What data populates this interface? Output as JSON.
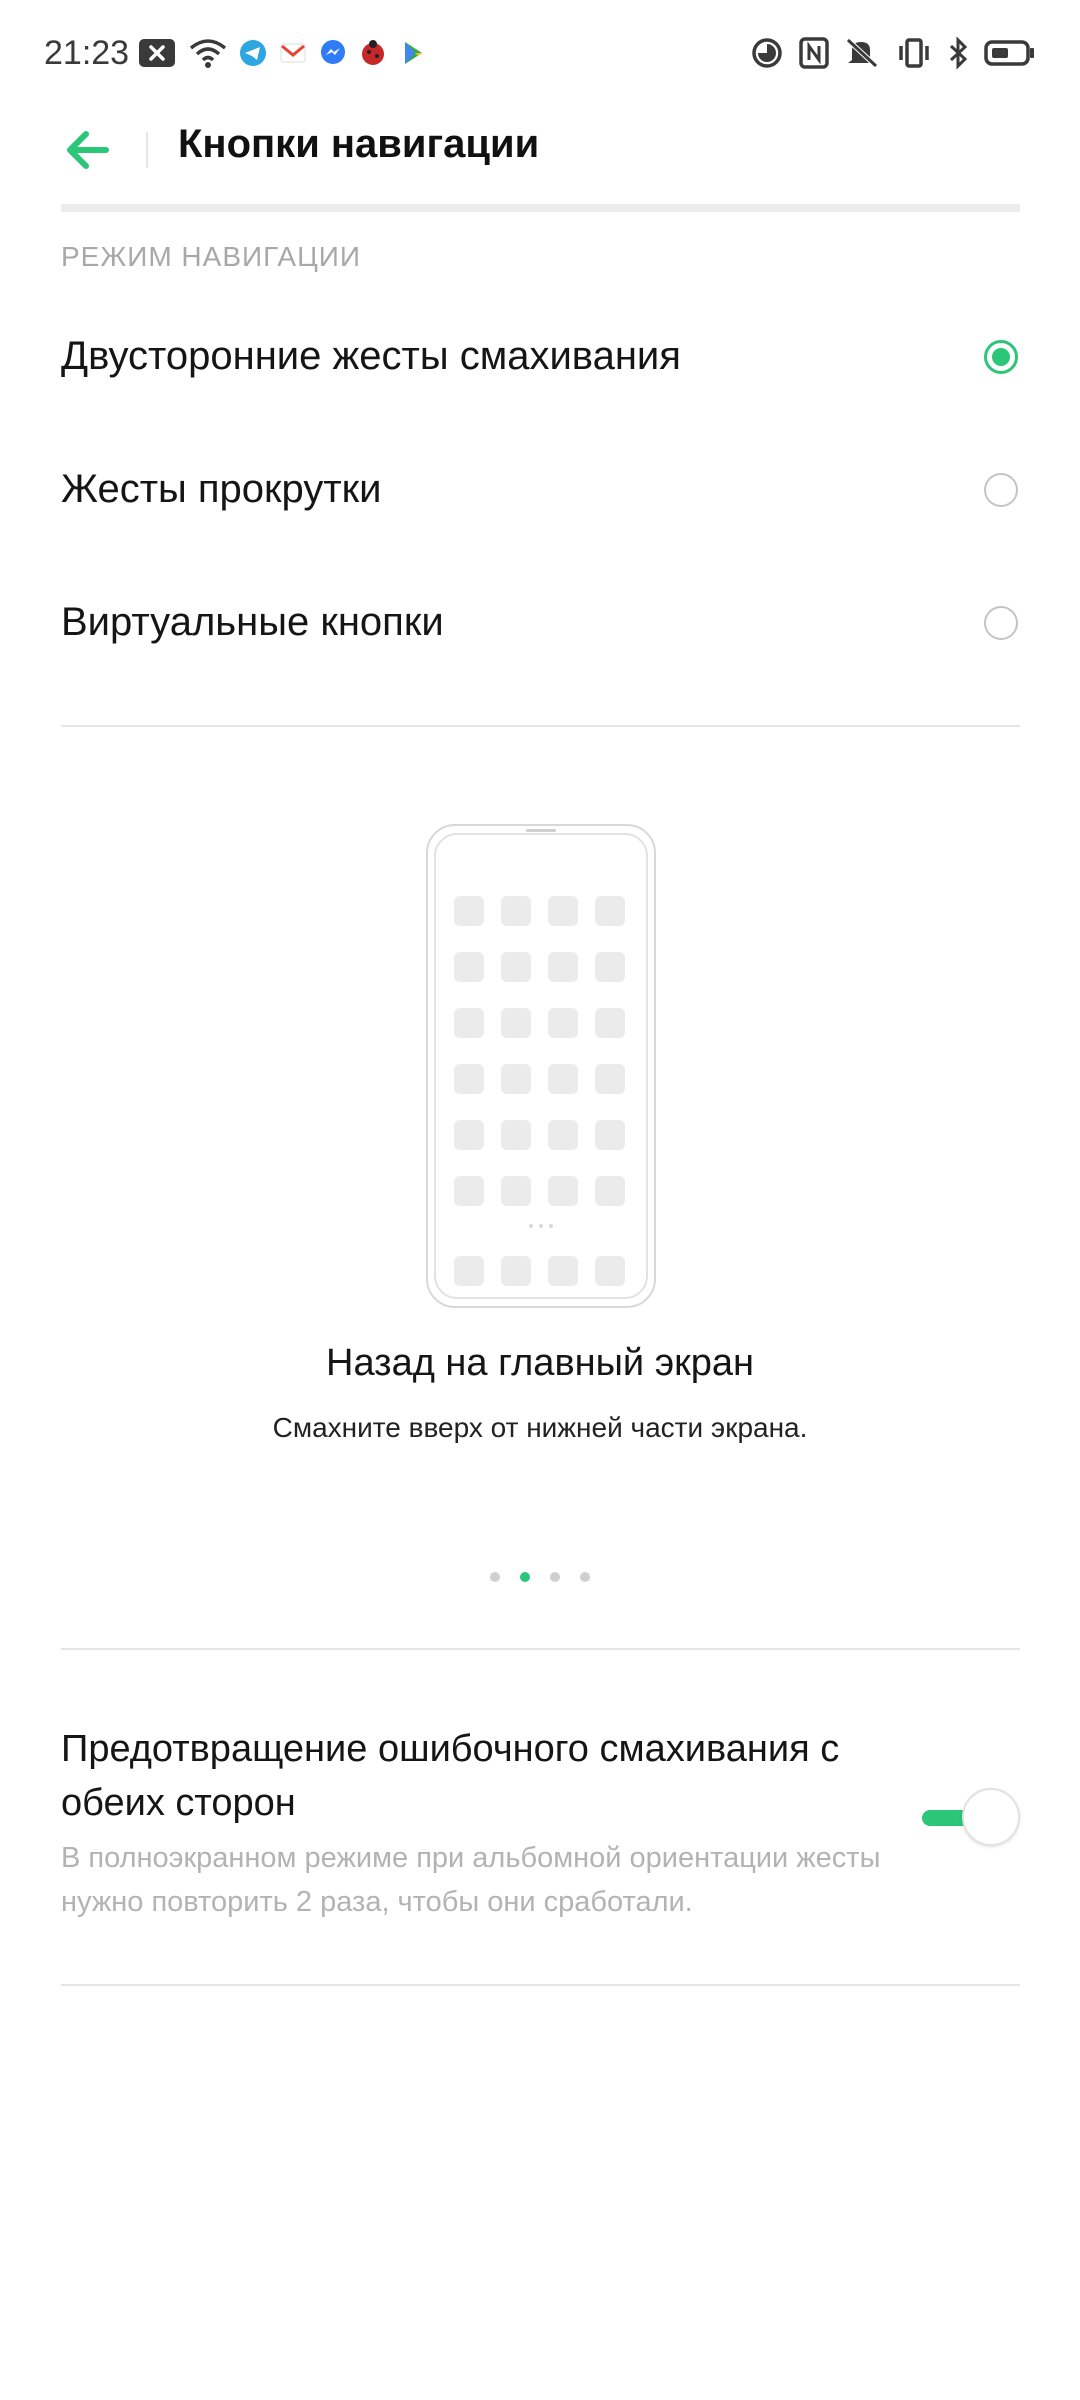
{
  "status_bar": {
    "time": "21:23",
    "left_icons": [
      "close-app-icon",
      "wifi-icon",
      "telegram-icon",
      "gmail-icon",
      "messenger-icon",
      "ladybug-app-icon",
      "play-store-icon"
    ],
    "right_icons": [
      "data-saver-icon",
      "nfc-icon",
      "mute-icon",
      "vibrate-icon",
      "bluetooth-icon",
      "battery-icon"
    ]
  },
  "header": {
    "title": "Кнопки навигации"
  },
  "navigation_mode": {
    "section_label": "РЕЖИМ НАВИГАЦИИ",
    "options": [
      {
        "label": "Двусторонние жесты смахивания",
        "selected": true
      },
      {
        "label": "Жесты прокрутки",
        "selected": false
      },
      {
        "label": "Виртуальные кнопки",
        "selected": false
      }
    ]
  },
  "illustration": {
    "title": "Назад на главный экран",
    "subtitle": "Смахните вверх от нижней части экрана.",
    "pages": 4,
    "active_page": 2
  },
  "false_swipe": {
    "title": "Предотвращение ошибочного смахивания с обеих сторон",
    "description": "В полноэкранном режиме при альбомной ориентации жесты нужно повторить 2 раза, чтобы они сработали.",
    "enabled": true
  },
  "colors": {
    "accent": "#2bc677",
    "divider": "#e6e6e6",
    "secondary_text": "#a8a8a8"
  }
}
